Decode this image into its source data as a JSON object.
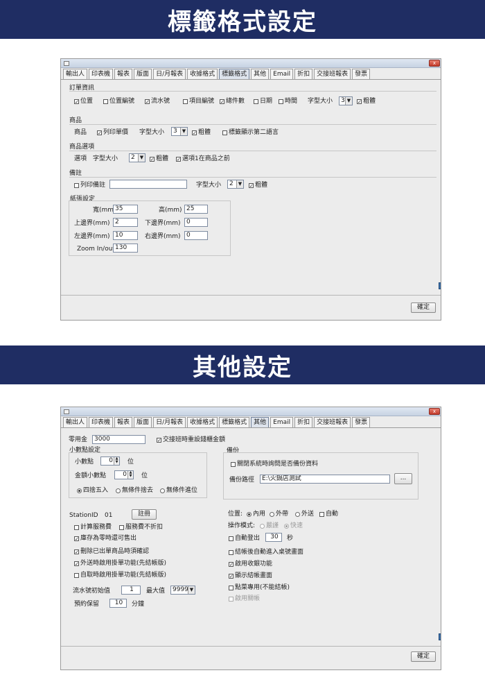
{
  "banner1": "標籤格式設定",
  "banner2": "其他設定",
  "tabs": [
    "輸出人",
    "印表機",
    "報表",
    "版面",
    "日/月報表",
    "收據格式",
    "標籤格式",
    "其他",
    "Email",
    "折扣",
    "交接班報表",
    "發票"
  ],
  "close_glyph": "x",
  "label_settings": {
    "order": {
      "title": "訂單資訊",
      "items": [
        {
          "label": "位置",
          "checked": true
        },
        {
          "label": "位置編號",
          "checked": false
        },
        {
          "label": "流水號",
          "checked": true
        },
        {
          "label": "項目編號",
          "checked": false
        },
        {
          "label": "總件數",
          "checked": true
        },
        {
          "label": "日期",
          "checked": false
        },
        {
          "label": "時間",
          "checked": false
        }
      ],
      "font_size_label": "字型大小",
      "font_size": "3",
      "bold_label": "粗體",
      "bold": true
    },
    "product": {
      "title": "商品",
      "row_label": "商品",
      "print_price_label": "列印單價",
      "print_price": true,
      "font_size_label": "字型大小",
      "font_size": "3",
      "bold_label": "粗體",
      "bold": true,
      "second_lang_label": "標籤顯示第二語言",
      "second_lang": false
    },
    "option": {
      "title": "商品選項",
      "row_label": "選項",
      "font_size_label": "字型大小",
      "font_size": "2",
      "bold_label": "粗體",
      "bold": true,
      "before_label": "選項1在商品之前",
      "before": true
    },
    "note": {
      "title": "備註",
      "print_label": "列印備註",
      "print": false,
      "text": "",
      "font_size_label": "字型大小",
      "font_size": "2",
      "bold_label": "粗體",
      "bold": true
    },
    "paper": {
      "title": "紙張設定",
      "width_label": "寬(mm)",
      "width": "35",
      "height_label": "高(mm)",
      "height": "25",
      "top_label": "上邊界(mm)",
      "top": "2",
      "bottom_label": "下邊界(mm)",
      "bottom": "0",
      "left_label": "左邊界(mm)",
      "left": "10",
      "right_label": "右邊界(mm)",
      "right": "0",
      "zoom_label": "Zoom In/out",
      "zoom": "130"
    },
    "ok_label": "確定"
  },
  "other_settings": {
    "petty_cash_label": "零用金",
    "petty_cash": "3000",
    "reset_cash_label": "交接班時重設錢櫃金額",
    "reset_cash": true,
    "decimal": {
      "title": "小數點設定",
      "decimal_label": "小數點",
      "decimal": "0",
      "decimal_unit": "位",
      "amount_decimal_label": "金額小數點",
      "amount_decimal": "0",
      "amount_decimal_unit": "位",
      "rounding": [
        "四捨五入",
        "無條件捨去",
        "無條件進位"
      ],
      "rounding_selected": 0
    },
    "backup": {
      "title": "備份",
      "ask_label": "關閉系統時詢問是否備份資料",
      "ask": false,
      "path_label": "備份路徑",
      "path": "E:\\火鍋店測試",
      "browse_label": "..."
    },
    "station_label": "StationID",
    "station_id": "01",
    "register_label": "註冊",
    "left_checks": [
      {
        "label": "計算服務費",
        "checked": false
      },
      {
        "label": "服務費不折扣",
        "checked": false
      },
      {
        "label": "庫存為零時還可售出",
        "checked": true
      },
      {
        "label": "刪除已出單商品時須確認",
        "checked": true
      },
      {
        "label": "外送時啟用掛單功能(先結帳版)",
        "checked": true
      },
      {
        "label": "自取時啟用掛單功能(先結帳版)",
        "checked": false
      }
    ],
    "serial_start_label": "流水號初始值",
    "serial_start": "1",
    "serial_max_label": "最大值",
    "serial_max": "9999",
    "reserve_label": "預約保留",
    "reserve": "10",
    "reserve_unit": "分鐘",
    "position_label": "位置:",
    "positions": [
      "內用",
      "外帶",
      "外送"
    ],
    "position_selected": 0,
    "auto_label": "自動",
    "auto": false,
    "mode_label": "操作模式:",
    "modes": [
      "嚴謹",
      "快速"
    ],
    "mode_selected": 1,
    "auto_logout_label": "自動登出",
    "auto_logout": false,
    "auto_logout_value": "30",
    "auto_logout_unit": "秒",
    "right_checks": [
      {
        "label": "結帳後自動進入桌號畫面",
        "checked": false
      },
      {
        "label": "啟用收銀功能",
        "checked": true
      },
      {
        "label": "顯示結帳畫面",
        "checked": true
      },
      {
        "label": "點菜專用(不能結帳)",
        "checked": false
      },
      {
        "label": "啟用關帳",
        "checked": false,
        "disabled": true
      }
    ],
    "ok_label": "確定"
  }
}
